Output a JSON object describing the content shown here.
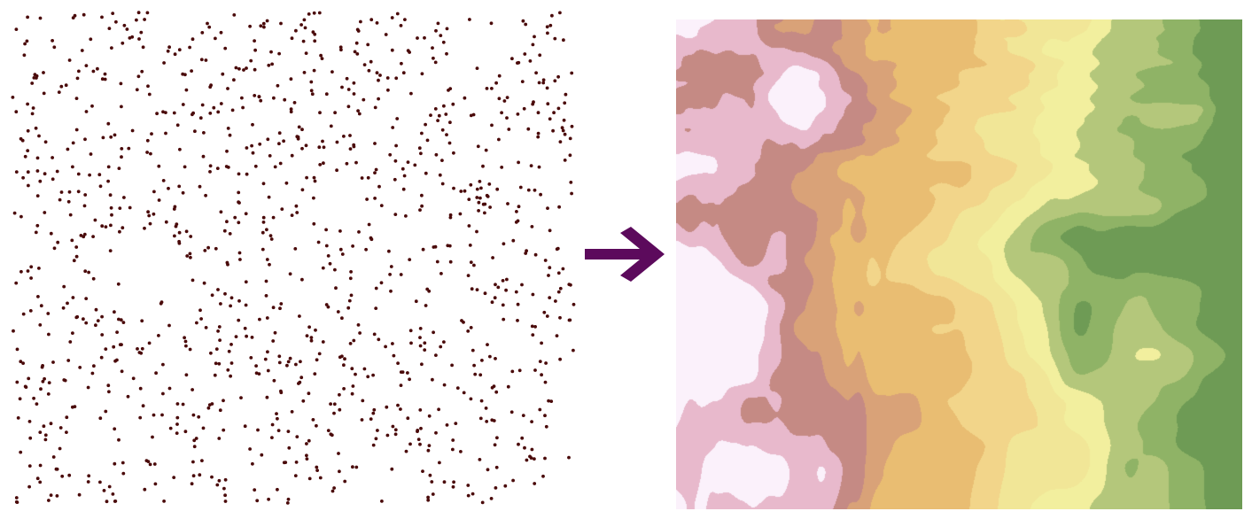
{
  "colors": {
    "background": "#ffffff",
    "point": "#4a0a0a",
    "arrow": "#5c0a5c",
    "ramp": [
      "#fbf1fb",
      "#e8b9cc",
      "#c58a84",
      "#d9a278",
      "#e9bd72",
      "#f2d58a",
      "#f1e697",
      "#f2ef9e",
      "#b4c77b",
      "#8fb366",
      "#6e9b55"
    ]
  },
  "icons": {
    "transform": "right-arrow-icon"
  },
  "scatter": {
    "point_count": 1150,
    "seed": 7
  },
  "map": {
    "seed": 42,
    "levels": 11
  }
}
